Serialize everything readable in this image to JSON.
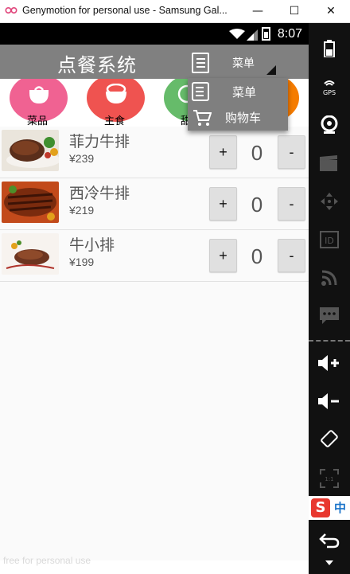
{
  "window": {
    "title": "Genymotion for personal use - Samsung Gal...",
    "minimize_glyph": "—",
    "maximize_glyph": "☐",
    "close_glyph": "✕"
  },
  "statusbar": {
    "time": "8:07"
  },
  "appbar": {
    "title": "点餐系统",
    "spinner_value": "菜单"
  },
  "categories": [
    {
      "label": "菜品",
      "color": "#f06292"
    },
    {
      "label": "主食",
      "color": "#ef5350"
    },
    {
      "label": "甜",
      "color": "#66bb6a"
    },
    {
      "label": "",
      "color": "#f57c00"
    }
  ],
  "dropdown": {
    "items": [
      {
        "label": "菜单",
        "icon": "menu-list-icon"
      },
      {
        "label": "购物车",
        "icon": "shopping-cart-icon"
      }
    ]
  },
  "products": [
    {
      "name": "菲力牛排",
      "price": "¥239",
      "qty": "0"
    },
    {
      "name": "西冷牛排",
      "price": "¥219",
      "qty": "0"
    },
    {
      "name": "牛小排",
      "price": "¥199",
      "qty": "0"
    }
  ],
  "buttons": {
    "plus": "+",
    "minus": "-"
  },
  "watermark": "free for personal use",
  "sidebar": {
    "gps_label": "GPS",
    "id_label": "ID",
    "ime_label": "中",
    "scale_label": "1:1"
  }
}
